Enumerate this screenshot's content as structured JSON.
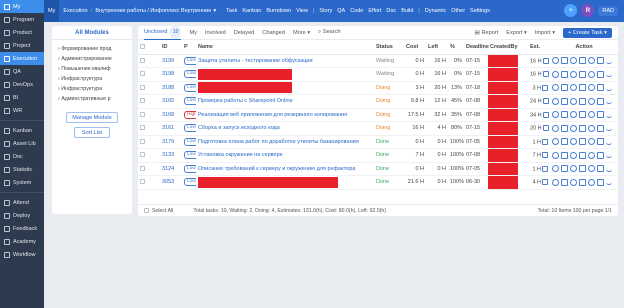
{
  "sidebar": {
    "items": [
      {
        "label": "My",
        "icon": "home-icon",
        "active": true
      },
      {
        "label": "Program",
        "icon": "program-icon"
      },
      {
        "label": "Product",
        "icon": "product-icon"
      },
      {
        "label": "Project",
        "icon": "project-icon"
      },
      {
        "label": "Execution",
        "icon": "execution-icon",
        "active": true
      },
      {
        "label": "QA",
        "icon": "qa-icon"
      },
      {
        "label": "DevOps",
        "icon": "devops-icon"
      },
      {
        "label": "BI",
        "icon": "bi-icon"
      },
      {
        "label": "WR",
        "icon": "report-icon"
      },
      {
        "label": "Kanban",
        "icon": "kanban-icon"
      },
      {
        "label": "Asset Lib",
        "icon": "asset-icon"
      },
      {
        "label": "Doc",
        "icon": "doc-icon"
      },
      {
        "label": "Statistic",
        "icon": "statistic-icon"
      },
      {
        "label": "System",
        "icon": "system-icon"
      },
      {
        "label": "Attend",
        "icon": "attend-icon"
      },
      {
        "label": "Deploy",
        "icon": "deploy-icon"
      },
      {
        "label": "Feedback",
        "icon": "feedback-icon"
      },
      {
        "label": "Academy",
        "icon": "academy-icon"
      },
      {
        "label": "Workflow",
        "icon": "workflow-icon"
      }
    ]
  },
  "topbar": {
    "my": "My",
    "module": "Execution",
    "breadcrumb": "Внутренние работы / Инфоплекс Внутренние",
    "nav": [
      "Task",
      "Kanban",
      "Burndown",
      "View",
      "Story",
      "QA",
      "Code",
      "Effort",
      "Doc",
      "Build",
      "Dynamic",
      "Other",
      "Settings"
    ],
    "avatar": "R",
    "user": "RAD",
    "colors": {
      "bar": "#2a68c9",
      "accent": "#3d8eea"
    }
  },
  "left_panel": {
    "title": "All Modules",
    "tree": [
      {
        "label": "Формирование прод",
        "child": false
      },
      {
        "label": "Администрирование",
        "child": false
      },
      {
        "label": "Повышение квалиф",
        "child": false
      },
      {
        "label": "Инфраструктура",
        "child": false
      },
      {
        "label": "Инфраструктура",
        "child": false
      },
      {
        "label": "Админстративные р",
        "child": false
      }
    ],
    "manage_button": "Manage Module",
    "list_button": "Sort List"
  },
  "main": {
    "filters": {
      "unclosed": "Unclosed",
      "unclosed_count": "10",
      "my": "My",
      "involved": "Involved",
      "delayed": "Delayed",
      "changed": "Changed",
      "more": "More",
      "search": "Search"
    },
    "actions": {
      "report": "Report",
      "export": "Export",
      "import": "Import",
      "create": "+ Create Task"
    },
    "columns": [
      "ID",
      "P",
      "Name",
      "Status",
      "Cost",
      "Left",
      "%",
      "Deadline",
      "CreatedBy",
      "",
      "Est.",
      "Action"
    ],
    "rows": [
      {
        "id": "3199",
        "p": "Low",
        "name": "Защита утилиты - тестирование обфускации",
        "status": "Waiting",
        "cost": "0 H",
        "left": "16 H",
        "pct": "0%",
        "deadline": "07-15",
        "est": "16 H",
        "redacted": false
      },
      {
        "id": "3198",
        "p": "Low",
        "name": "",
        "status": "Waiting",
        "cost": "0 H",
        "left": "16 H",
        "pct": "0%",
        "deadline": "07-15",
        "est": "16 H",
        "redacted": true
      },
      {
        "id": "3188",
        "p": "Low",
        "name": "",
        "status": "Doing",
        "cost": "3 H",
        "left": "20 H",
        "pct": "13%",
        "deadline": "07-18",
        "est": "3 H",
        "redacted": true
      },
      {
        "id": "3165",
        "p": "Low",
        "name": "Проверка работы с Sharepoint Online",
        "status": "Doing",
        "cost": "9.8 H",
        "left": "12 H",
        "pct": "45%",
        "deadline": "07-08",
        "est": "24 H",
        "redacted": false
      },
      {
        "id": "3168",
        "p": "High",
        "name": "Реализация веб приложения для резервного копирования",
        "status": "Doing",
        "cost": "17.5 H",
        "left": "32 H",
        "pct": "35%",
        "deadline": "07-08",
        "est": "34 H",
        "redacted": false
      },
      {
        "id": "3161",
        "p": "Low",
        "name": "Сборка и запуск исходного кода",
        "status": "Doing",
        "cost": "16 H",
        "left": "4 H",
        "pct": "80%",
        "deadline": "07-15",
        "est": "20 H",
        "redacted": false
      },
      {
        "id": "3179",
        "p": "Low",
        "name": "Подготовка плана работ по доработке утилиты базанирования",
        "status": "Done",
        "cost": "0 H",
        "left": "0 H",
        "pct": "100%",
        "deadline": "07-05",
        "est": "1 H",
        "redacted": false
      },
      {
        "id": "3133",
        "p": "Low",
        "name": "Установка окружения на сервере",
        "status": "Done",
        "cost": "7 H",
        "left": "0 H",
        "pct": "100%",
        "deadline": "07-08",
        "est": "7 H",
        "redacted": false
      },
      {
        "id": "3124",
        "p": "Low",
        "name": "Описание требований к серверу и окружению для рефактора",
        "status": "Done",
        "cost": "0 H",
        "left": "0 H",
        "pct": "100%",
        "deadline": "07-05",
        "est": "1 H",
        "redacted": false
      },
      {
        "id": "3053",
        "p": "Low",
        "name": "",
        "status": "Done",
        "cost": "21.6 H",
        "left": "0 H",
        "pct": "100%",
        "deadline": "06-30",
        "est": "4 H",
        "redacted": true
      }
    ],
    "footer": {
      "select_all": "Select All",
      "summary": "Total tasks: 10, Waiting: 2, Doing: 4, Estimates: 131.0(h), Cost: 80.0(h), Left: 92.0(h)",
      "pager": "Total: 10 Items   100 per page   1/1"
    }
  }
}
